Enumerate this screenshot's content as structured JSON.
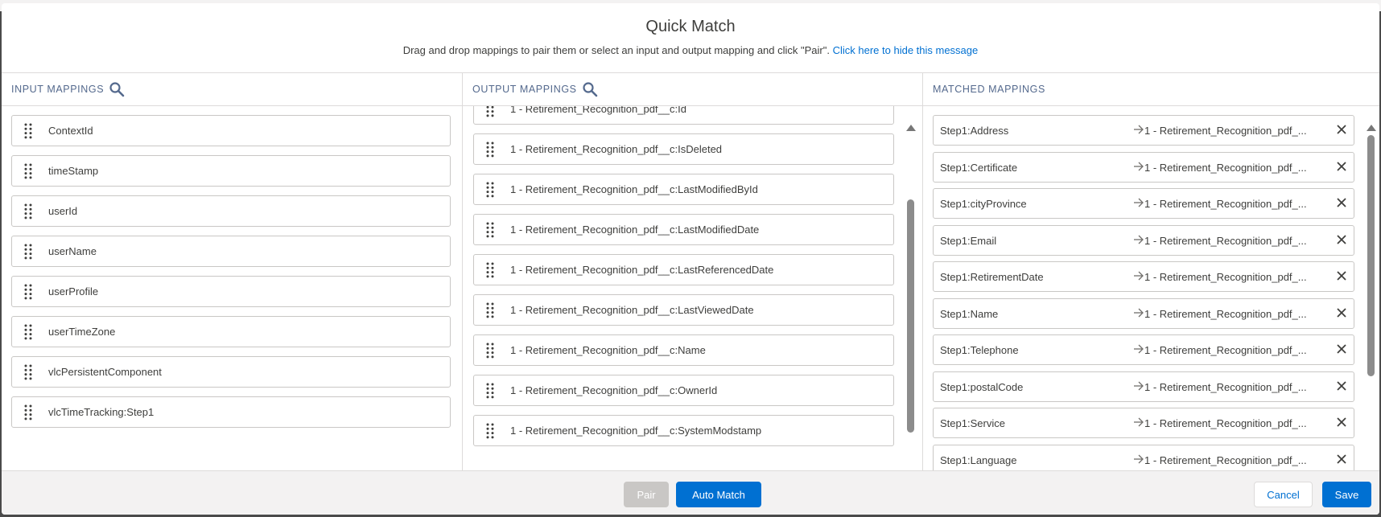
{
  "modal": {
    "title": "Quick Match",
    "subtitle": "Drag and drop mappings to pair them or select an input and output mapping and click \"Pair\".",
    "hide_link": "Click here to hide this message"
  },
  "columns": {
    "input_heading": "INPUT MAPPINGS",
    "output_heading": "OUTPUT MAPPINGS",
    "matched_heading": "MATCHED MAPPINGS"
  },
  "input_items": [
    "ContextId",
    "timeStamp",
    "userId",
    "userName",
    "userProfile",
    "userTimeZone",
    "vlcPersistentComponent",
    "vlcTimeTracking:Step1"
  ],
  "output_items": [
    "1 - Retirement_Recognition_pdf__c:Id",
    "1 - Retirement_Recognition_pdf__c:IsDeleted",
    "1 - Retirement_Recognition_pdf__c:LastModifiedById",
    "1 - Retirement_Recognition_pdf__c:LastModifiedDate",
    "1 - Retirement_Recognition_pdf__c:LastReferencedDate",
    "1 - Retirement_Recognition_pdf__c:LastViewedDate",
    "1 - Retirement_Recognition_pdf__c:Name",
    "1 - Retirement_Recognition_pdf__c:OwnerId",
    "1 - Retirement_Recognition_pdf__c:SystemModstamp"
  ],
  "matched_items": [
    {
      "input": "Step1:Address",
      "output": "1 - Retirement_Recognition_pdf_..."
    },
    {
      "input": "Step1:Certificate",
      "output": "1 - Retirement_Recognition_pdf_..."
    },
    {
      "input": "Step1:cityProvince",
      "output": "1 - Retirement_Recognition_pdf_..."
    },
    {
      "input": "Step1:Email",
      "output": "1 - Retirement_Recognition_pdf_..."
    },
    {
      "input": "Step1:RetirementDate",
      "output": "1 - Retirement_Recognition_pdf_..."
    },
    {
      "input": "Step1:Name",
      "output": "1 - Retirement_Recognition_pdf_..."
    },
    {
      "input": "Step1:Telephone",
      "output": "1 - Retirement_Recognition_pdf_..."
    },
    {
      "input": "Step1:postalCode",
      "output": "1 - Retirement_Recognition_pdf_..."
    },
    {
      "input": "Step1:Service",
      "output": "1 - Retirement_Recognition_pdf_..."
    },
    {
      "input": "Step1:Language",
      "output": "1 - Retirement_Recognition_pdf_..."
    }
  ],
  "footer": {
    "pair_label": "Pair",
    "auto_match_label": "Auto Match",
    "cancel_label": "Cancel",
    "save_label": "Save"
  },
  "icons": {
    "search": "search-icon",
    "drag": "drag-handle-icon",
    "arrow": "arrow-right-icon",
    "remove": "close-icon"
  },
  "colors": {
    "accent": "#0070d2",
    "disabled_button": "#c9c7c5",
    "footer_bg": "#f3f2f2",
    "border": "#dddbda"
  }
}
